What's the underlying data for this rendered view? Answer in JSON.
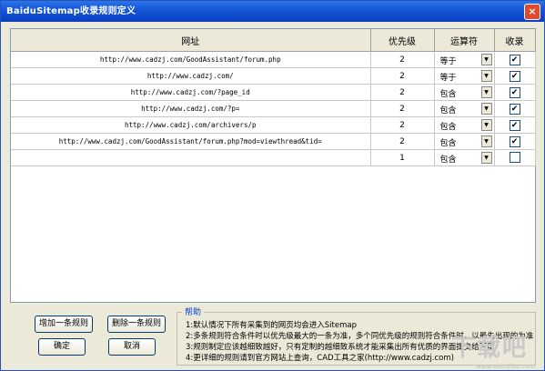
{
  "window": {
    "title": "BaiduSitemap收录规则定义",
    "close_label": "×"
  },
  "table": {
    "headers": [
      "网址",
      "优先级",
      "运算符",
      "收录"
    ],
    "rows": [
      {
        "url": "http://www.cadzj.com/GoodAssistant/forum.php",
        "priority": "2",
        "operator": "等于",
        "checked": true
      },
      {
        "url": "http://www.cadzj.com/",
        "priority": "2",
        "operator": "等于",
        "checked": true
      },
      {
        "url": "http://www.cadzj.com/?page_id",
        "priority": "2",
        "operator": "包含",
        "checked": true
      },
      {
        "url": "http://www.cadzj.com/?p=",
        "priority": "2",
        "operator": "包含",
        "checked": true
      },
      {
        "url": "http://www.cadzj.com/archivers/p",
        "priority": "2",
        "operator": "包含",
        "checked": true
      },
      {
        "url": "http://www.cadzj.com/GoodAssistant/forum.php?mod=viewthread&tid=",
        "priority": "2",
        "operator": "包含",
        "checked": true
      },
      {
        "url": "",
        "priority": "1",
        "operator": "包含",
        "checked": false
      }
    ]
  },
  "buttons": {
    "add": "增加一条规则",
    "delete": "删除一条规则",
    "ok": "确定",
    "cancel": "取消"
  },
  "help": {
    "legend": "帮助",
    "lines": [
      "1:默认情况下所有采集到的网页均会进入Sitemap",
      "2:多条规则符合条件时以优先级最大的一条为准，多个同优先级的规则符合条件时，以最先出现的为准",
      "3:规则制定应该越细致越好，只有定制的越细致系统才能采集出所有优质的界面提交给百度",
      "4:更详细的规则请到官方网站上查询，CAD工具之家(http://www.cadzj.com)"
    ]
  },
  "watermark": {
    "text": "下载吧",
    "sub": "www.xiazaiba.com"
  }
}
